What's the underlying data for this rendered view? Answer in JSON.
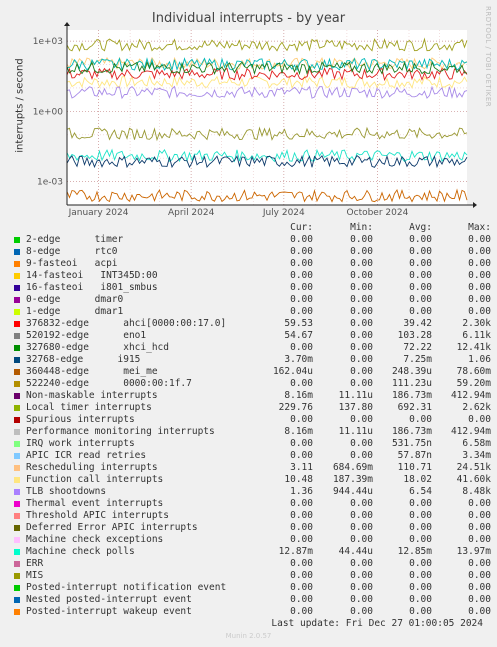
{
  "chart_data": {
    "type": "line",
    "title": "Individual interrupts - by year",
    "ylabel": "interrupts / second",
    "yscale": "log",
    "ylim": [
      0.0001,
      3000
    ],
    "yticks": [
      {
        "v": 1000,
        "label": "1e+03"
      },
      {
        "v": 1,
        "label": "1e+00"
      },
      {
        "v": 0.001,
        "label": "1e-03"
      }
    ],
    "xrange": [
      "2023-12-01",
      "2024-12-28"
    ],
    "xticks": [
      {
        "date": "2024-01-01",
        "label": "January 2024"
      },
      {
        "date": "2024-04-01",
        "label": "April 2024"
      },
      {
        "date": "2024-07-01",
        "label": "July 2024"
      },
      {
        "date": "2024-10-01",
        "label": "October 2024"
      }
    ],
    "grid": true,
    "series": [
      {
        "name": "Function call interrupts",
        "color": "#ffe680",
        "level": 18.02
      },
      {
        "name": "Rescheduling interrupts",
        "color": "#ffcc77",
        "level": 110.71
      },
      {
        "name": "Local timer interrupts",
        "color": "#a0a020",
        "level": 692.31
      },
      {
        "name": "TLB shootdowns",
        "color": "#a88ae8",
        "level": 6.54
      },
      {
        "name": "376832-edge ahci",
        "color": "#e02020",
        "level": 39.42
      },
      {
        "name": "520192-edge eno1",
        "color": "#00b8b8",
        "level": 103.28
      },
      {
        "name": "327680-edge xhci_hcd",
        "color": "#1a7a1a",
        "level": 72.22
      },
      {
        "name": "522240-edge",
        "color": "#999933",
        "level": 0.11
      },
      {
        "name": "Machine check polls",
        "color": "#1de3c8",
        "level": 0.01285
      },
      {
        "name": "32768-edge i915",
        "color": "#0d3a6b",
        "level": 0.00725
      },
      {
        "name": "360448-edge mei_me",
        "color": "#cc6600",
        "level": 0.000248
      }
    ],
    "legend_header": {
      "cur": "Cur:",
      "min": "Min:",
      "avg": "Avg:",
      "max": "Max:"
    },
    "legend": [
      {
        "label": "2-edge      timer",
        "color": "#00cc00",
        "cur": "0.00",
        "min": "0.00",
        "avg": "0.00",
        "max": "0.00"
      },
      {
        "label": "8-edge      rtc0",
        "color": "#0066b3",
        "cur": "0.00",
        "min": "0.00",
        "avg": "0.00",
        "max": "0.00"
      },
      {
        "label": "9-fasteoi   acpi",
        "color": "#ff8000",
        "cur": "0.00",
        "min": "0.00",
        "avg": "0.00",
        "max": "0.00"
      },
      {
        "label": "14-fasteoi   INT345D:00",
        "color": "#ffcc00",
        "cur": "0.00",
        "min": "0.00",
        "avg": "0.00",
        "max": "0.00"
      },
      {
        "label": "16-fasteoi   i801_smbus",
        "color": "#330099",
        "cur": "0.00",
        "min": "0.00",
        "avg": "0.00",
        "max": "0.00"
      },
      {
        "label": "0-edge      dmar0",
        "color": "#990099",
        "cur": "0.00",
        "min": "0.00",
        "avg": "0.00",
        "max": "0.00"
      },
      {
        "label": "1-edge      dmar1",
        "color": "#ccff00",
        "cur": "0.00",
        "min": "0.00",
        "avg": "0.00",
        "max": "0.00"
      },
      {
        "label": "376832-edge      ahci[0000:00:17.0]",
        "color": "#ff0000",
        "cur": "59.53",
        "min": "0.00",
        "avg": "39.42",
        "max": "2.30k"
      },
      {
        "label": "520192-edge      eno1",
        "color": "#808080",
        "cur": "54.67",
        "min": "0.00",
        "avg": "103.28",
        "max": "6.11k"
      },
      {
        "label": "327680-edge      xhci_hcd",
        "color": "#008f00",
        "cur": "0.00",
        "min": "0.00",
        "avg": "72.22",
        "max": "12.41k"
      },
      {
        "label": "32768-edge      i915",
        "color": "#00487d",
        "cur": "3.70m",
        "min": "0.00",
        "avg": "7.25m",
        "max": "1.06"
      },
      {
        "label": "360448-edge      mei_me",
        "color": "#b35a00",
        "cur": "162.04u",
        "min": "0.00",
        "avg": "248.39u",
        "max": "78.60m"
      },
      {
        "label": "522240-edge      0000:00:1f.7",
        "color": "#b38f00",
        "cur": "0.00",
        "min": "0.00",
        "avg": "111.23u",
        "max": "59.20m"
      },
      {
        "label": "Non-maskable interrupts",
        "color": "#6b006b",
        "cur": "8.16m",
        "min": "11.11u",
        "avg": "186.73m",
        "max": "412.94m"
      },
      {
        "label": "Local timer interrupts",
        "color": "#8fb300",
        "cur": "229.76",
        "min": "137.80",
        "avg": "692.31",
        "max": "2.62k"
      },
      {
        "label": "Spurious interrupts",
        "color": "#b30000",
        "cur": "0.00",
        "min": "0.00",
        "avg": "0.00",
        "max": "0.00"
      },
      {
        "label": "Performance monitoring interrupts",
        "color": "#bebebe",
        "cur": "8.16m",
        "min": "11.11u",
        "avg": "186.73m",
        "max": "412.94m"
      },
      {
        "label": "IRQ work interrupts",
        "color": "#80ff80",
        "cur": "0.00",
        "min": "0.00",
        "avg": "531.75n",
        "max": "6.58m"
      },
      {
        "label": "APIC ICR read retries",
        "color": "#80c9ff",
        "cur": "0.00",
        "min": "0.00",
        "avg": "57.87n",
        "max": "3.34m"
      },
      {
        "label": "Rescheduling interrupts",
        "color": "#ffc080",
        "cur": "3.11",
        "min": "684.69m",
        "avg": "110.71",
        "max": "24.51k"
      },
      {
        "label": "Function call interrupts",
        "color": "#ffe680",
        "cur": "10.48",
        "min": "187.39m",
        "avg": "18.02",
        "max": "41.60k"
      },
      {
        "label": "TLB shootdowns",
        "color": "#aa80ff",
        "cur": "1.36",
        "min": "944.44u",
        "avg": "6.54",
        "max": "8.48k"
      },
      {
        "label": "Thermal event interrupts",
        "color": "#ee00cc",
        "cur": "0.00",
        "min": "0.00",
        "avg": "0.00",
        "max": "0.00"
      },
      {
        "label": "Threshold APIC interrupts",
        "color": "#ff8080",
        "cur": "0.00",
        "min": "0.00",
        "avg": "0.00",
        "max": "0.00"
      },
      {
        "label": "Deferred Error APIC interrupts",
        "color": "#666600",
        "cur": "0.00",
        "min": "0.00",
        "avg": "0.00",
        "max": "0.00"
      },
      {
        "label": "Machine check exceptions",
        "color": "#ffbfff",
        "cur": "0.00",
        "min": "0.00",
        "avg": "0.00",
        "max": "0.00"
      },
      {
        "label": "Machine check polls",
        "color": "#00ffcc",
        "cur": "12.87m",
        "min": "44.44u",
        "avg": "12.85m",
        "max": "13.97m"
      },
      {
        "label": "ERR",
        "color": "#cc6699",
        "cur": "0.00",
        "min": "0.00",
        "avg": "0.00",
        "max": "0.00"
      },
      {
        "label": "MIS",
        "color": "#999900",
        "cur": "0.00",
        "min": "0.00",
        "avg": "0.00",
        "max": "0.00"
      },
      {
        "label": "Posted-interrupt notification event",
        "color": "#00cc00",
        "cur": "0.00",
        "min": "0.00",
        "avg": "0.00",
        "max": "0.00"
      },
      {
        "label": "Nested posted-interrupt event",
        "color": "#0066b3",
        "cur": "0.00",
        "min": "0.00",
        "avg": "0.00",
        "max": "0.00"
      },
      {
        "label": "Posted-interrupt wakeup event",
        "color": "#ff8000",
        "cur": "0.00",
        "min": "0.00",
        "avg": "0.00",
        "max": "0.00"
      }
    ]
  },
  "side_label": "RRDTOOL / TOBI OETIKER",
  "footer": "Last update: Fri Dec 27 01:00:05 2024",
  "munin_version": "Munin 2.0.57"
}
